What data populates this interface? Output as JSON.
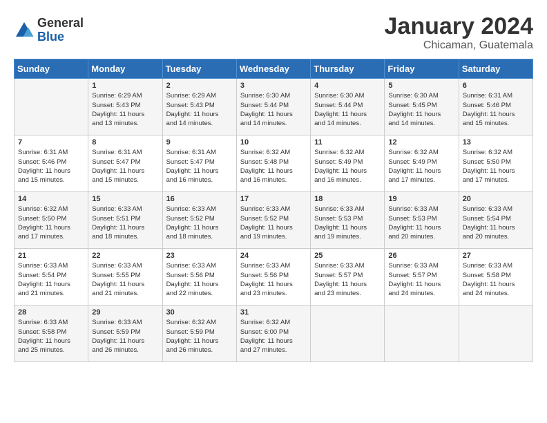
{
  "logo": {
    "general": "General",
    "blue": "Blue"
  },
  "title": "January 2024",
  "location": "Chicaman, Guatemala",
  "headers": [
    "Sunday",
    "Monday",
    "Tuesday",
    "Wednesday",
    "Thursday",
    "Friday",
    "Saturday"
  ],
  "weeks": [
    [
      {
        "day": "",
        "info": ""
      },
      {
        "day": "1",
        "info": "Sunrise: 6:29 AM\nSunset: 5:43 PM\nDaylight: 11 hours\nand 13 minutes."
      },
      {
        "day": "2",
        "info": "Sunrise: 6:29 AM\nSunset: 5:43 PM\nDaylight: 11 hours\nand 14 minutes."
      },
      {
        "day": "3",
        "info": "Sunrise: 6:30 AM\nSunset: 5:44 PM\nDaylight: 11 hours\nand 14 minutes."
      },
      {
        "day": "4",
        "info": "Sunrise: 6:30 AM\nSunset: 5:44 PM\nDaylight: 11 hours\nand 14 minutes."
      },
      {
        "day": "5",
        "info": "Sunrise: 6:30 AM\nSunset: 5:45 PM\nDaylight: 11 hours\nand 14 minutes."
      },
      {
        "day": "6",
        "info": "Sunrise: 6:31 AM\nSunset: 5:46 PM\nDaylight: 11 hours\nand 15 minutes."
      }
    ],
    [
      {
        "day": "7",
        "info": "Sunrise: 6:31 AM\nSunset: 5:46 PM\nDaylight: 11 hours\nand 15 minutes."
      },
      {
        "day": "8",
        "info": "Sunrise: 6:31 AM\nSunset: 5:47 PM\nDaylight: 11 hours\nand 15 minutes."
      },
      {
        "day": "9",
        "info": "Sunrise: 6:31 AM\nSunset: 5:47 PM\nDaylight: 11 hours\nand 16 minutes."
      },
      {
        "day": "10",
        "info": "Sunrise: 6:32 AM\nSunset: 5:48 PM\nDaylight: 11 hours\nand 16 minutes."
      },
      {
        "day": "11",
        "info": "Sunrise: 6:32 AM\nSunset: 5:49 PM\nDaylight: 11 hours\nand 16 minutes."
      },
      {
        "day": "12",
        "info": "Sunrise: 6:32 AM\nSunset: 5:49 PM\nDaylight: 11 hours\nand 17 minutes."
      },
      {
        "day": "13",
        "info": "Sunrise: 6:32 AM\nSunset: 5:50 PM\nDaylight: 11 hours\nand 17 minutes."
      }
    ],
    [
      {
        "day": "14",
        "info": "Sunrise: 6:32 AM\nSunset: 5:50 PM\nDaylight: 11 hours\nand 17 minutes."
      },
      {
        "day": "15",
        "info": "Sunrise: 6:33 AM\nSunset: 5:51 PM\nDaylight: 11 hours\nand 18 minutes."
      },
      {
        "day": "16",
        "info": "Sunrise: 6:33 AM\nSunset: 5:52 PM\nDaylight: 11 hours\nand 18 minutes."
      },
      {
        "day": "17",
        "info": "Sunrise: 6:33 AM\nSunset: 5:52 PM\nDaylight: 11 hours\nand 19 minutes."
      },
      {
        "day": "18",
        "info": "Sunrise: 6:33 AM\nSunset: 5:53 PM\nDaylight: 11 hours\nand 19 minutes."
      },
      {
        "day": "19",
        "info": "Sunrise: 6:33 AM\nSunset: 5:53 PM\nDaylight: 11 hours\nand 20 minutes."
      },
      {
        "day": "20",
        "info": "Sunrise: 6:33 AM\nSunset: 5:54 PM\nDaylight: 11 hours\nand 20 minutes."
      }
    ],
    [
      {
        "day": "21",
        "info": "Sunrise: 6:33 AM\nSunset: 5:54 PM\nDaylight: 11 hours\nand 21 minutes."
      },
      {
        "day": "22",
        "info": "Sunrise: 6:33 AM\nSunset: 5:55 PM\nDaylight: 11 hours\nand 21 minutes."
      },
      {
        "day": "23",
        "info": "Sunrise: 6:33 AM\nSunset: 5:56 PM\nDaylight: 11 hours\nand 22 minutes."
      },
      {
        "day": "24",
        "info": "Sunrise: 6:33 AM\nSunset: 5:56 PM\nDaylight: 11 hours\nand 23 minutes."
      },
      {
        "day": "25",
        "info": "Sunrise: 6:33 AM\nSunset: 5:57 PM\nDaylight: 11 hours\nand 23 minutes."
      },
      {
        "day": "26",
        "info": "Sunrise: 6:33 AM\nSunset: 5:57 PM\nDaylight: 11 hours\nand 24 minutes."
      },
      {
        "day": "27",
        "info": "Sunrise: 6:33 AM\nSunset: 5:58 PM\nDaylight: 11 hours\nand 24 minutes."
      }
    ],
    [
      {
        "day": "28",
        "info": "Sunrise: 6:33 AM\nSunset: 5:58 PM\nDaylight: 11 hours\nand 25 minutes."
      },
      {
        "day": "29",
        "info": "Sunrise: 6:33 AM\nSunset: 5:59 PM\nDaylight: 11 hours\nand 26 minutes."
      },
      {
        "day": "30",
        "info": "Sunrise: 6:32 AM\nSunset: 5:59 PM\nDaylight: 11 hours\nand 26 minutes."
      },
      {
        "day": "31",
        "info": "Sunrise: 6:32 AM\nSunset: 6:00 PM\nDaylight: 11 hours\nand 27 minutes."
      },
      {
        "day": "",
        "info": ""
      },
      {
        "day": "",
        "info": ""
      },
      {
        "day": "",
        "info": ""
      }
    ]
  ]
}
